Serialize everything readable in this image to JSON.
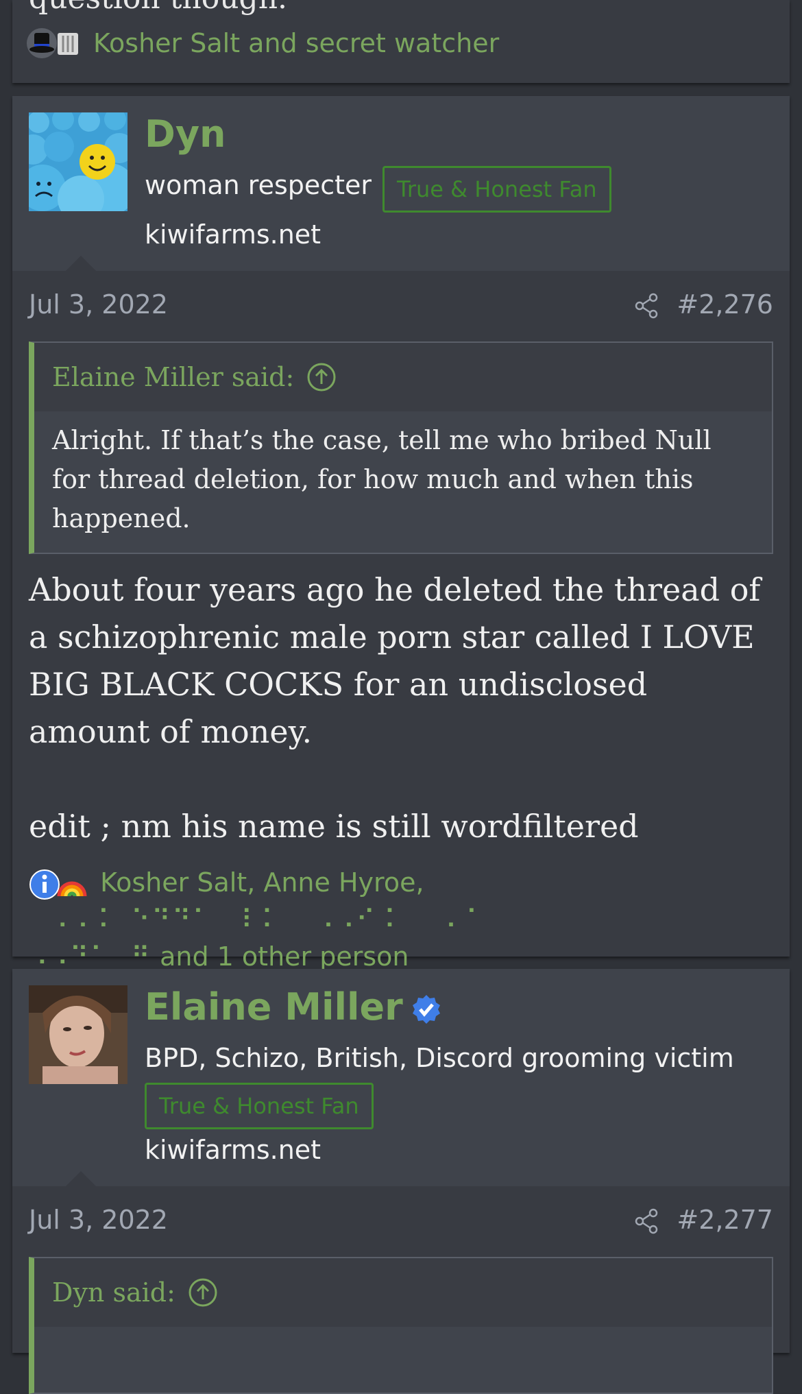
{
  "prev_post": {
    "cut_text": "question though.",
    "reactions_text": "Kosher Salt and secret watcher",
    "reaction_icons": [
      "top-hat-icon",
      "bucket-icon"
    ]
  },
  "posts": [
    {
      "username": "Dyn",
      "user_title": "woman respecter",
      "banner": "True & Honest Fan",
      "site": "kiwifarms.net",
      "date": "Jul 3, 2022",
      "number": "#2,276",
      "quote": {
        "author": "Elaine Miller said:",
        "text": "Alright. If that’s the case, tell me who bribed Null for thread deletion, for how much and when this happened."
      },
      "message_p1": "About four years ago he deleted the thread of a schizophrenic male porn star called I LOVE BIG BLACK COCKS for an undisclosed amount of money.",
      "message_p2": "edit ; nm his name is still wordfiltered",
      "reactions": {
        "icons": [
          "informative-icon",
          "rainbow-icon"
        ],
        "names": "Kosher Salt, Anne Hyroe,",
        "braille_1": "⠀⠠⠠⠨⠀⠑⠙⠙⠁⠀⠸⠨⠀⠀⠠⠠⠊⠨⠀⠀⠠⠈",
        "braille_2": "⠠⠠⠙⠁⠀⠛",
        "others": "and 1 other person"
      }
    },
    {
      "username": "Elaine Miller",
      "verified": true,
      "user_title": "BPD, Schizo, British, Discord grooming victim",
      "banner": "True & Honest Fan",
      "site": "kiwifarms.net",
      "date": "Jul 3, 2022",
      "number": "#2,277",
      "quote": {
        "author": "Dyn said:"
      }
    }
  ],
  "colors": {
    "accent": "#7ba65e",
    "banner": "#3f8a2e",
    "background": "#2f3238",
    "card": "#383b42"
  }
}
